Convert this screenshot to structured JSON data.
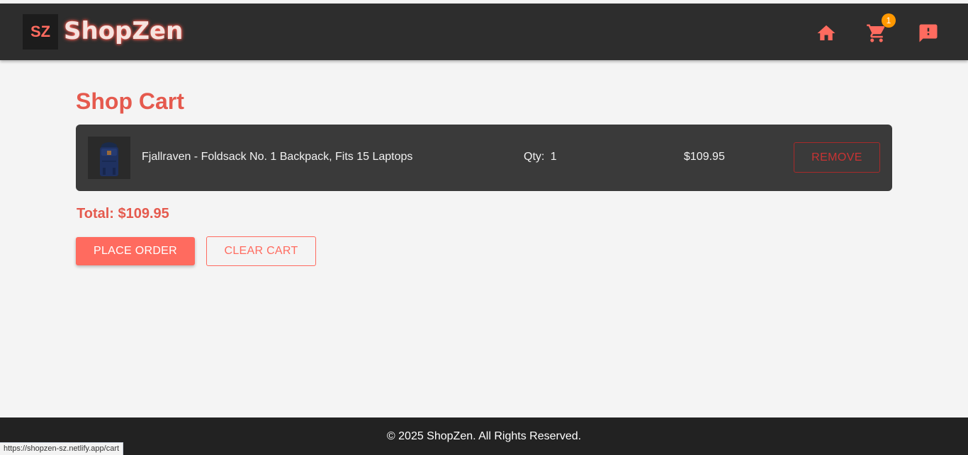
{
  "header": {
    "logo_badge": "SZ",
    "brand": "ShopZen",
    "cart_count": "1",
    "icons": [
      "home-icon",
      "cart-icon",
      "feedback-icon"
    ]
  },
  "cart": {
    "title": "Shop Cart",
    "items": [
      {
        "name": "Fjallraven - Foldsack No. 1 Backpack, Fits 15 Laptops",
        "qty_label": "Qty:",
        "qty": "1",
        "price": "$109.95",
        "remove_label": "REMOVE"
      }
    ],
    "total": "Total: $109.95",
    "place_order_label": "PLACE ORDER",
    "clear_cart_label": "CLEAR CART"
  },
  "footer": {
    "text": "© 2025 ShopZen. All Rights Reserved."
  },
  "status_bar": {
    "url": "https://shopzen-sz.netlify.app/cart"
  },
  "colors": {
    "accent": "#ff6b5f",
    "navbar": "#2d2d2d",
    "badge": "#ff9800",
    "remove": "#c93333"
  }
}
